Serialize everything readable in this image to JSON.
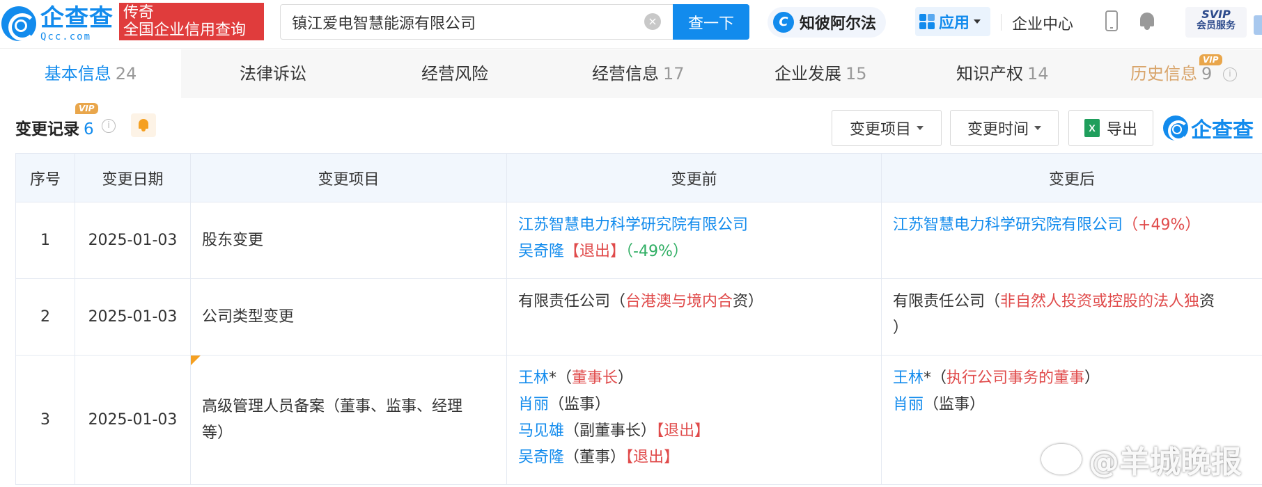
{
  "header": {
    "logo_name": "企查查",
    "logo_domain": "Qcc.com",
    "badge_line1": "传奇",
    "badge_line2": "全国企业信用查询",
    "search_value": "镇江爱电智慧能源有限公司",
    "search_button": "查一下",
    "clear_glyph": "×",
    "zhibi_label": "知彼阿尔法",
    "zhibi_glyph": "C",
    "apps_label": "应用",
    "enterprise_center": "企业中心",
    "svip_top": "SVIP",
    "svip_bottom": "会员服务",
    "accent_color": "#128bed"
  },
  "tabs": [
    {
      "label": "基本信息",
      "count": "24"
    },
    {
      "label": "法律诉讼",
      "count": ""
    },
    {
      "label": "经营风险",
      "count": ""
    },
    {
      "label": "经营信息",
      "count": "17"
    },
    {
      "label": "企业发展",
      "count": "15"
    },
    {
      "label": "知识产权",
      "count": "14"
    },
    {
      "label": "历史信息",
      "count": "9",
      "vip": "VIP"
    }
  ],
  "section": {
    "title": "变更记录",
    "count": "6",
    "vip": "VIP",
    "info_glyph": "i",
    "filter_item": "变更项目",
    "filter_time": "变更时间",
    "export": "导出",
    "excel_glyph": "X",
    "brand": "企查查"
  },
  "table": {
    "headers": [
      "序号",
      "变更日期",
      "变更项目",
      "变更前",
      "变更后"
    ],
    "rows": [
      {
        "index": "1",
        "date": "2025-01-03",
        "item": "股东变更",
        "before": {
          "line1_name": "江苏智慧电力科学研究院有限公司",
          "line2_name": "吴奇隆",
          "line2_exit": "【退出】",
          "line2_pct": "（-49%）"
        },
        "after": {
          "line1_name": "江苏智慧电力科学研究院有限公司",
          "line1_pct": "（+49%）"
        }
      },
      {
        "index": "2",
        "date": "2025-01-03",
        "item": "公司类型变更",
        "before": {
          "prefix": "有限责任公司（",
          "highlight": "台港澳与境内合",
          "suffix": "资）"
        },
        "after": {
          "prefix": "有限责任公司（",
          "highlight": "非自然人投资或控股的法人独",
          "suffix": "资",
          "line2": "）"
        }
      },
      {
        "index": "3",
        "date": "2025-01-03",
        "item_line1": "高级管理人员备案（董事、监事、经理",
        "item_line2": "等）",
        "before": [
          {
            "name": "王林",
            "mark": "*",
            "open": "（",
            "role": "董事长",
            "close": "）",
            "role_red": true,
            "exit": ""
          },
          {
            "name": "肖丽",
            "mark": "",
            "open": "（",
            "role": "监事",
            "close": "）",
            "role_red": false,
            "exit": ""
          },
          {
            "name": "马见雄",
            "mark": "",
            "open": "（",
            "role": "副董事长",
            "close": "）",
            "role_red": false,
            "exit": "【退出】"
          },
          {
            "name": "吴奇隆",
            "mark": "",
            "open": "（",
            "role": "董事",
            "close": "）",
            "role_red": false,
            "exit": "【退出】"
          }
        ],
        "after": [
          {
            "name": "王林",
            "mark": "*",
            "open": "（",
            "role": "执行公司事务的董事",
            "close": "）",
            "role_red": true
          },
          {
            "name": "肖丽",
            "mark": "",
            "open": "（",
            "role": "监事",
            "close": "）",
            "role_red": false
          }
        ]
      }
    ]
  },
  "watermark": "@羊城晚报"
}
